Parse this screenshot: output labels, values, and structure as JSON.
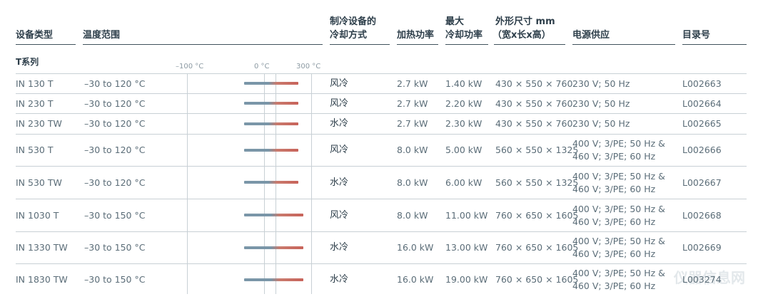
{
  "headers": {
    "type": "设备类型",
    "range": "温度范围",
    "cooling_l1": "制冷设备的",
    "cooling_l2": "冷却方式",
    "heating": "加热功率",
    "max_l1": "最大",
    "max_l2": "冷却功率",
    "dims_l1": "外形尺寸 mm",
    "dims_l2": "（宽x长x高）",
    "power": "电源供应",
    "catalog": "目录号"
  },
  "section_title": "T系列",
  "scale": {
    "min_label": "–100 °C",
    "zero_label": "0 °C",
    "max_label": "300 °C",
    "min": -100,
    "max": 300
  },
  "rows": [
    {
      "type": "IN 130 T",
      "range": "–30 to 120 °C",
      "low": -30,
      "high": 120,
      "cooling": "风冷",
      "heating": "2.7 kW",
      "max_cooling": "1.40 kW",
      "dims": "430 × 550 × 760",
      "power1": "230 V; 50 Hz",
      "power2": "",
      "catalog": "L002663"
    },
    {
      "type": "IN 230 T",
      "range": "–30 to 120 °C",
      "low": -30,
      "high": 120,
      "cooling": "风冷",
      "heating": "2.7 kW",
      "max_cooling": "2.20 kW",
      "dims": "430 × 550 × 760",
      "power1": "230 V; 50 Hz",
      "power2": "",
      "catalog": "L002664"
    },
    {
      "type": "IN 230 TW",
      "range": "–30 to 120 °C",
      "low": -30,
      "high": 120,
      "cooling": "水冷",
      "heating": "2.7 kW",
      "max_cooling": "2.30 kW",
      "dims": "430 × 550 × 760",
      "power1": "230 V; 50 Hz",
      "power2": "",
      "catalog": "L002665"
    },
    {
      "type": "IN 530 T",
      "range": "–30 to 120 °C",
      "low": -30,
      "high": 120,
      "cooling": "风冷",
      "heating": "8.0 kW",
      "max_cooling": "5.00 kW",
      "dims": "560 × 550 × 1325",
      "power1": "400 V; 3/PE; 50 Hz &",
      "power2": "460 V; 3/PE; 60 Hz",
      "catalog": "L002666"
    },
    {
      "type": "IN 530 TW",
      "range": "–30 to 120 °C",
      "low": -30,
      "high": 120,
      "cooling": "水冷",
      "heating": "8.0 kW",
      "max_cooling": "6.00 kW",
      "dims": "560 × 550 × 1325",
      "power1": "400 V; 3/PE; 50 Hz &",
      "power2": "460 V; 3/PE; 60 Hz",
      "catalog": "L002667"
    },
    {
      "type": "IN 1030 T",
      "range": "–30 to 150 °C",
      "low": -30,
      "high": 150,
      "cooling": "风冷",
      "heating": "8.0 kW",
      "max_cooling": "11.00 kW",
      "dims": "760 × 650 × 1605",
      "power1": "400 V; 3/PE; 50 Hz &",
      "power2": "460 V; 3/PE; 60 Hz",
      "catalog": "L002668"
    },
    {
      "type": "IN 1330 TW",
      "range": "–30 to 150 °C",
      "low": -30,
      "high": 150,
      "cooling": "水冷",
      "heating": "16.0 kW",
      "max_cooling": "13.00 kW",
      "dims": "760 × 650 × 1605",
      "power1": "400 V; 3/PE; 50 Hz &",
      "power2": "460 V; 3/PE; 60 Hz",
      "catalog": "L002669"
    },
    {
      "type": "IN 1830 TW",
      "range": "–30 to 150 °C",
      "low": -30,
      "high": 150,
      "cooling": "水冷",
      "heating": "16.0 kW",
      "max_cooling": "19.00 kW",
      "dims": "760 × 650 × 1605",
      "power1": "400 V; 3/PE; 50 Hz &",
      "power2": "460 V; 3/PE; 60 Hz",
      "catalog": "L003274"
    }
  ],
  "watermark": "仪器信息网",
  "colors": {
    "cold": "#7a96a8",
    "hot": "#c8635a",
    "text": "#5b6d78",
    "heading": "#2d3e4a"
  }
}
